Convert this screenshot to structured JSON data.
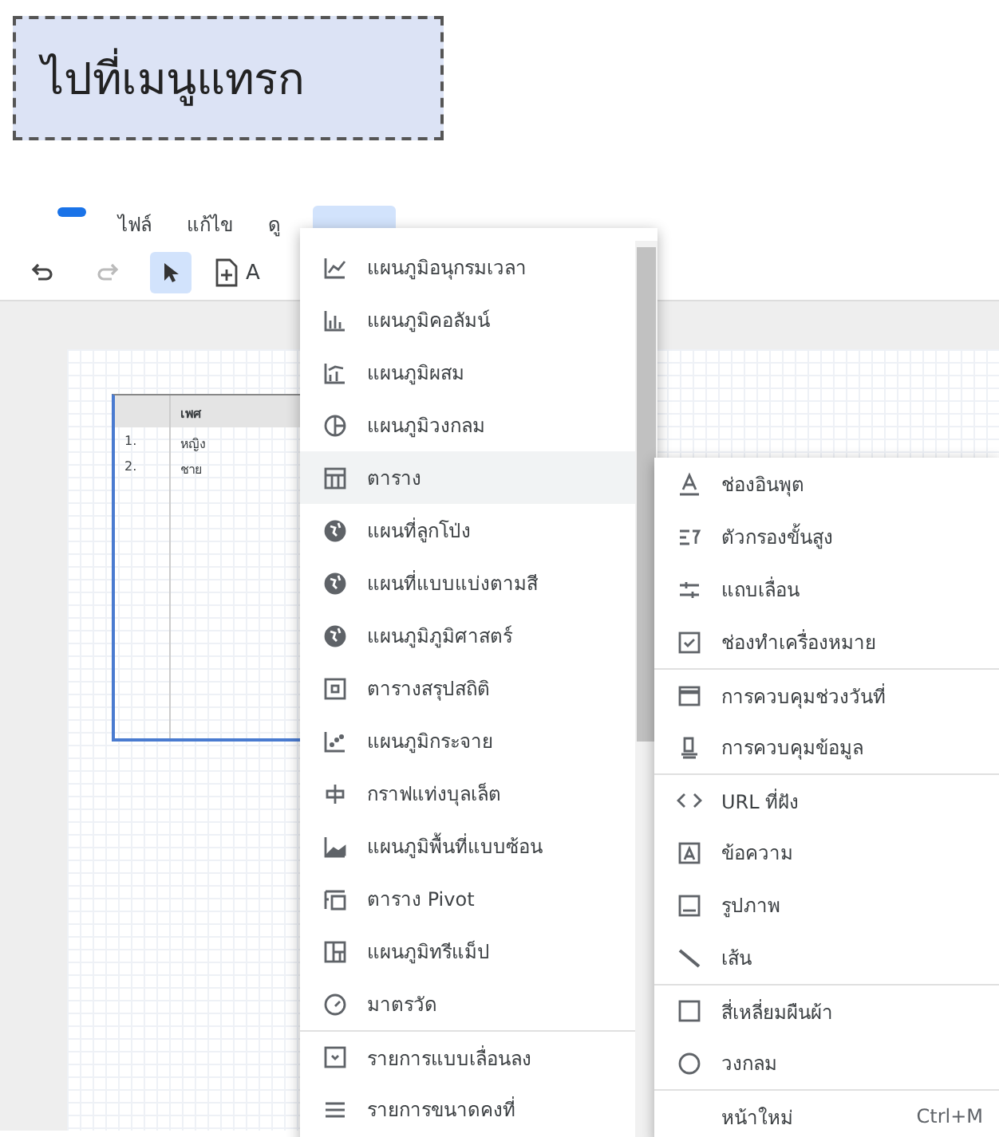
{
  "callout": {
    "text": "ไปที่เมนูแทรก"
  },
  "menubar": {
    "items": [
      {
        "label": "ไฟล์",
        "selected": false
      },
      {
        "label": "แก้ไข",
        "selected": false
      },
      {
        "label": "ดู",
        "selected": false
      }
    ],
    "insert_open": true
  },
  "toolbar": {
    "select_active": true,
    "add_page_label": "A"
  },
  "table": {
    "columns": [
      "เพศ"
    ],
    "rows": [
      {
        "index": "1.",
        "value": "หญิง"
      },
      {
        "index": "2.",
        "value": "ชาย"
      }
    ]
  },
  "chart_menu": {
    "items": [
      {
        "label": "แผนภูมิอนุกรมเวลา",
        "selected": false,
        "divider": false
      },
      {
        "label": "แผนภูมิคอลัมน์",
        "selected": false,
        "divider": false
      },
      {
        "label": "แผนภูมิผสม",
        "selected": false,
        "divider": false
      },
      {
        "label": "แผนภูมิวงกลม",
        "selected": false,
        "divider": false
      },
      {
        "label": "ตาราง",
        "selected": true,
        "divider": false
      },
      {
        "label": "แผนที่ลูกโป่ง",
        "selected": false,
        "divider": false
      },
      {
        "label": "แผนที่แบบแบ่งตามสี",
        "selected": false,
        "divider": false
      },
      {
        "label": "แผนภูมิภูมิศาสตร์",
        "selected": false,
        "divider": false
      },
      {
        "label": "ตารางสรุปสถิติ",
        "selected": false,
        "divider": false
      },
      {
        "label": "แผนภูมิกระจาย",
        "selected": false,
        "divider": false
      },
      {
        "label": "กราฟแท่งบุลเล็ต",
        "selected": false,
        "divider": false
      },
      {
        "label": "แผนภูมิพื้นที่แบบซ้อน",
        "selected": false,
        "divider": false
      },
      {
        "label": "ตาราง Pivot",
        "selected": false,
        "divider": false
      },
      {
        "label": "แผนภูมิทรีแม็ป",
        "selected": false,
        "divider": false
      },
      {
        "label": "มาตรวัด",
        "selected": false,
        "divider": false
      },
      {
        "label": "รายการแบบเลื่อนลง",
        "selected": false,
        "divider": true
      },
      {
        "label": "รายการขนาดคงที่",
        "selected": false,
        "divider": false
      }
    ]
  },
  "controls_menu": {
    "items": [
      {
        "label": "ช่องอินพุต",
        "divider": false
      },
      {
        "label": "ตัวกรองขั้นสูง",
        "divider": false
      },
      {
        "label": "แถบเลื่อน",
        "divider": false
      },
      {
        "label": "ช่องทำเครื่องหมาย",
        "divider": false
      },
      {
        "label": "การควบคุมช่วงวันที่",
        "divider": true
      },
      {
        "label": "การควบคุมข้อมูล",
        "divider": false
      },
      {
        "label": "URL ที่ฝัง",
        "divider": true
      },
      {
        "label": "ข้อความ",
        "divider": false
      },
      {
        "label": "รูปภาพ",
        "divider": false
      },
      {
        "label": "เส้น",
        "divider": false
      },
      {
        "label": "สี่เหลี่ยมผืนผ้า",
        "divider": true
      },
      {
        "label": "วงกลม",
        "divider": false
      },
      {
        "label": "หน้าใหม่",
        "shortcut": "Ctrl+M",
        "divider": true
      }
    ]
  }
}
